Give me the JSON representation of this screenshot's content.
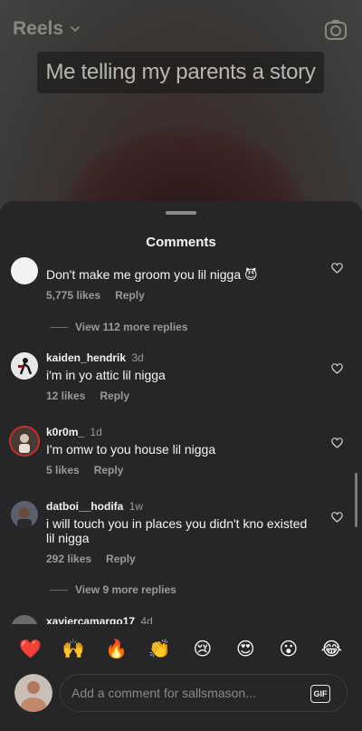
{
  "reel": {
    "title": "Reels",
    "caption": "Me telling my parents a story"
  },
  "sheet": {
    "title": "Comments"
  },
  "comments": [
    {
      "username": "",
      "time": "",
      "text": "Don't make me groom you lil nigga 😈",
      "likes": "5,775 likes",
      "reply": "Reply",
      "view_replies": "View 112 more replies"
    },
    {
      "username": "kaiden_hendrik",
      "time": "3d",
      "text": "i'm in yo attic lil nigga",
      "likes": "12 likes",
      "reply": "Reply"
    },
    {
      "username": "k0r0m_",
      "time": "1d",
      "text": "I'm omw to you house lil nigga",
      "likes": "5 likes",
      "reply": "Reply"
    },
    {
      "username": "datboi__hodifa",
      "time": "1w",
      "text": "i will touch you in places you didn't kno existed lil nigga",
      "likes": "292 likes",
      "reply": "Reply",
      "view_replies": "View 9 more replies"
    },
    {
      "username": "xaviercamargo17",
      "time": "4d"
    }
  ],
  "emojis": [
    "❤️",
    "🙌",
    "🔥",
    "👏",
    "😢",
    "😍",
    "😮",
    "😂"
  ],
  "composer": {
    "placeholder": "Add a comment for sallsmason...",
    "gif_label": "GIF"
  },
  "colors": {
    "sheet_bg": "#262628",
    "secondary_text": "#9a9a9c"
  }
}
